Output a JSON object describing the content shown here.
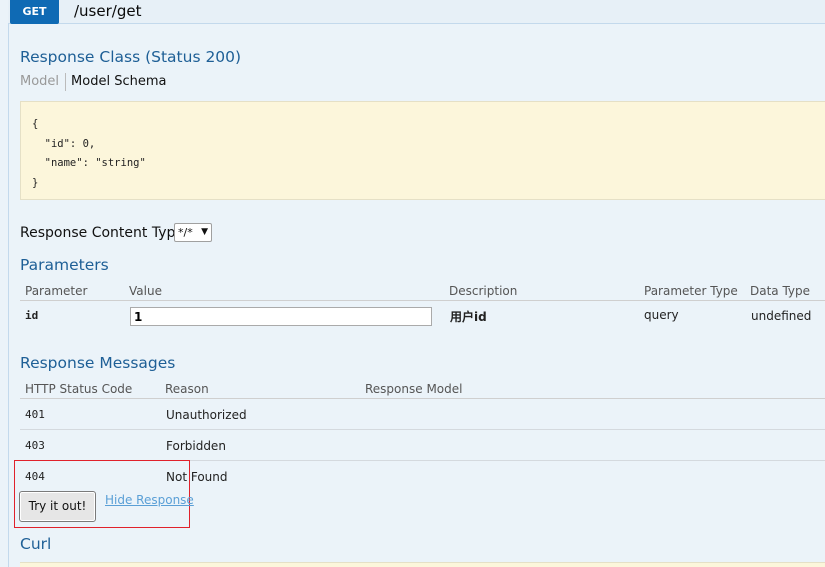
{
  "operation": {
    "method": "GET",
    "path": "/user/get"
  },
  "response_class": {
    "title": "Response Class (Status 200)",
    "tabs": [
      "Model",
      "Model Schema"
    ],
    "schema_lines": [
      "{",
      "  \"id\": 0,",
      "  \"name\": \"string\"",
      "}"
    ]
  },
  "content_type": {
    "label": "Response Content Type",
    "selected": "*/*",
    "arrow": "▼"
  },
  "parameters": {
    "title": "Parameters",
    "headers": [
      "Parameter",
      "Value",
      "Description",
      "Parameter Type",
      "Data Type"
    ],
    "rows": [
      {
        "name": "id",
        "value": "1",
        "description": "用户id",
        "param_type": "query",
        "data_type": "undefined"
      }
    ]
  },
  "response_messages": {
    "title": "Response Messages",
    "headers": [
      "HTTP Status Code",
      "Reason",
      "Response Model"
    ],
    "rows": [
      {
        "code": "401",
        "reason": "Unauthorized"
      },
      {
        "code": "403",
        "reason": "Forbidden"
      },
      {
        "code": "404",
        "reason": "Not Found"
      }
    ]
  },
  "actions": {
    "try_label": "Try it out!",
    "hide_label": "Hide Response"
  },
  "curl": {
    "title": "Curl"
  },
  "colors": {
    "method_bg": "#0f6ab4",
    "section_title": "#1e5f96",
    "highlight": "#e0212b",
    "schema_bg": "#fcf6db",
    "link": "#5a9fd6"
  }
}
